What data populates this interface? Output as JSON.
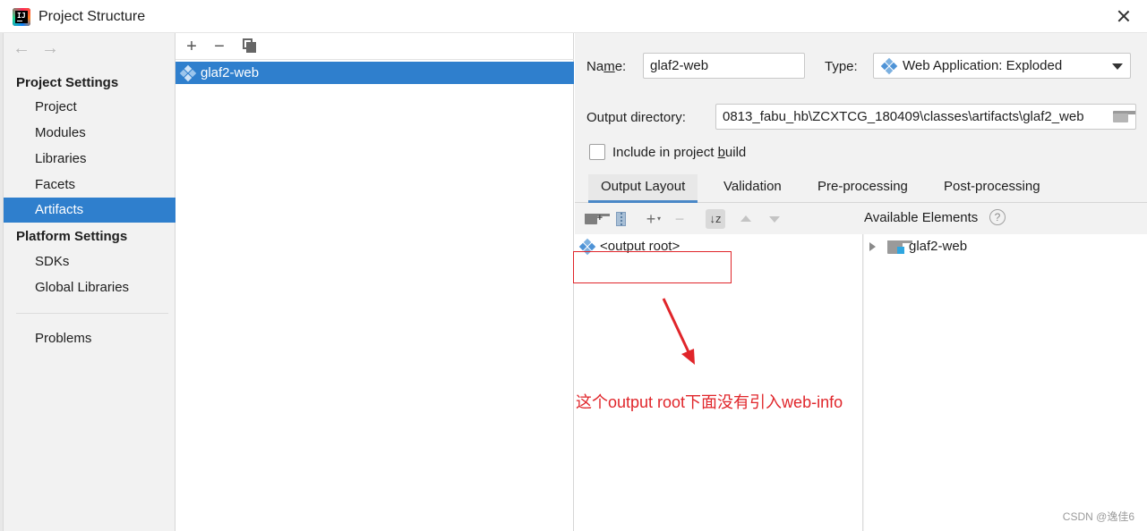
{
  "window": {
    "title": "Project Structure"
  },
  "sidebar": {
    "project_settings_heading": "Project Settings",
    "project_items": [
      {
        "label": "Project"
      },
      {
        "label": "Modules"
      },
      {
        "label": "Libraries"
      },
      {
        "label": "Facets"
      },
      {
        "label": "Artifacts",
        "selected": true
      }
    ],
    "platform_settings_heading": "Platform Settings",
    "platform_items": [
      {
        "label": "SDKs"
      },
      {
        "label": "Global Libraries"
      }
    ],
    "problems_label": "Problems"
  },
  "artifacts_list": {
    "items": [
      {
        "label": "glaf2-web",
        "icon": "web-app-icon",
        "selected": true
      }
    ]
  },
  "details": {
    "name_label": "Name:",
    "name_value": "glaf2-web",
    "type_label": "Type:",
    "type_value": "Web Application: Exploded",
    "output_dir_label": "Output directory:",
    "output_dir_value": "0813_fabu_hb\\ZCXTCG_180409\\classes\\artifacts\\glaf2_web",
    "include_in_build_label": "Include in project build",
    "include_in_build_checked": false,
    "tabs": [
      {
        "label": "Output Layout",
        "active": true
      },
      {
        "label": "Validation"
      },
      {
        "label": "Pre-processing"
      },
      {
        "label": "Post-processing"
      }
    ],
    "output_tree": {
      "root_label": "<output root>"
    },
    "available_elements_label": "Available Elements",
    "available_tree": [
      {
        "label": "glaf2-web",
        "collapsed": true
      }
    ],
    "annotation_text": "这个output root下面没有引入web-info"
  },
  "watermark": "CSDN @逸佳6",
  "colors": {
    "selection": "#2f7fcd",
    "annotation_red": "#e0252a",
    "panel_bg": "#f2f2f2"
  }
}
